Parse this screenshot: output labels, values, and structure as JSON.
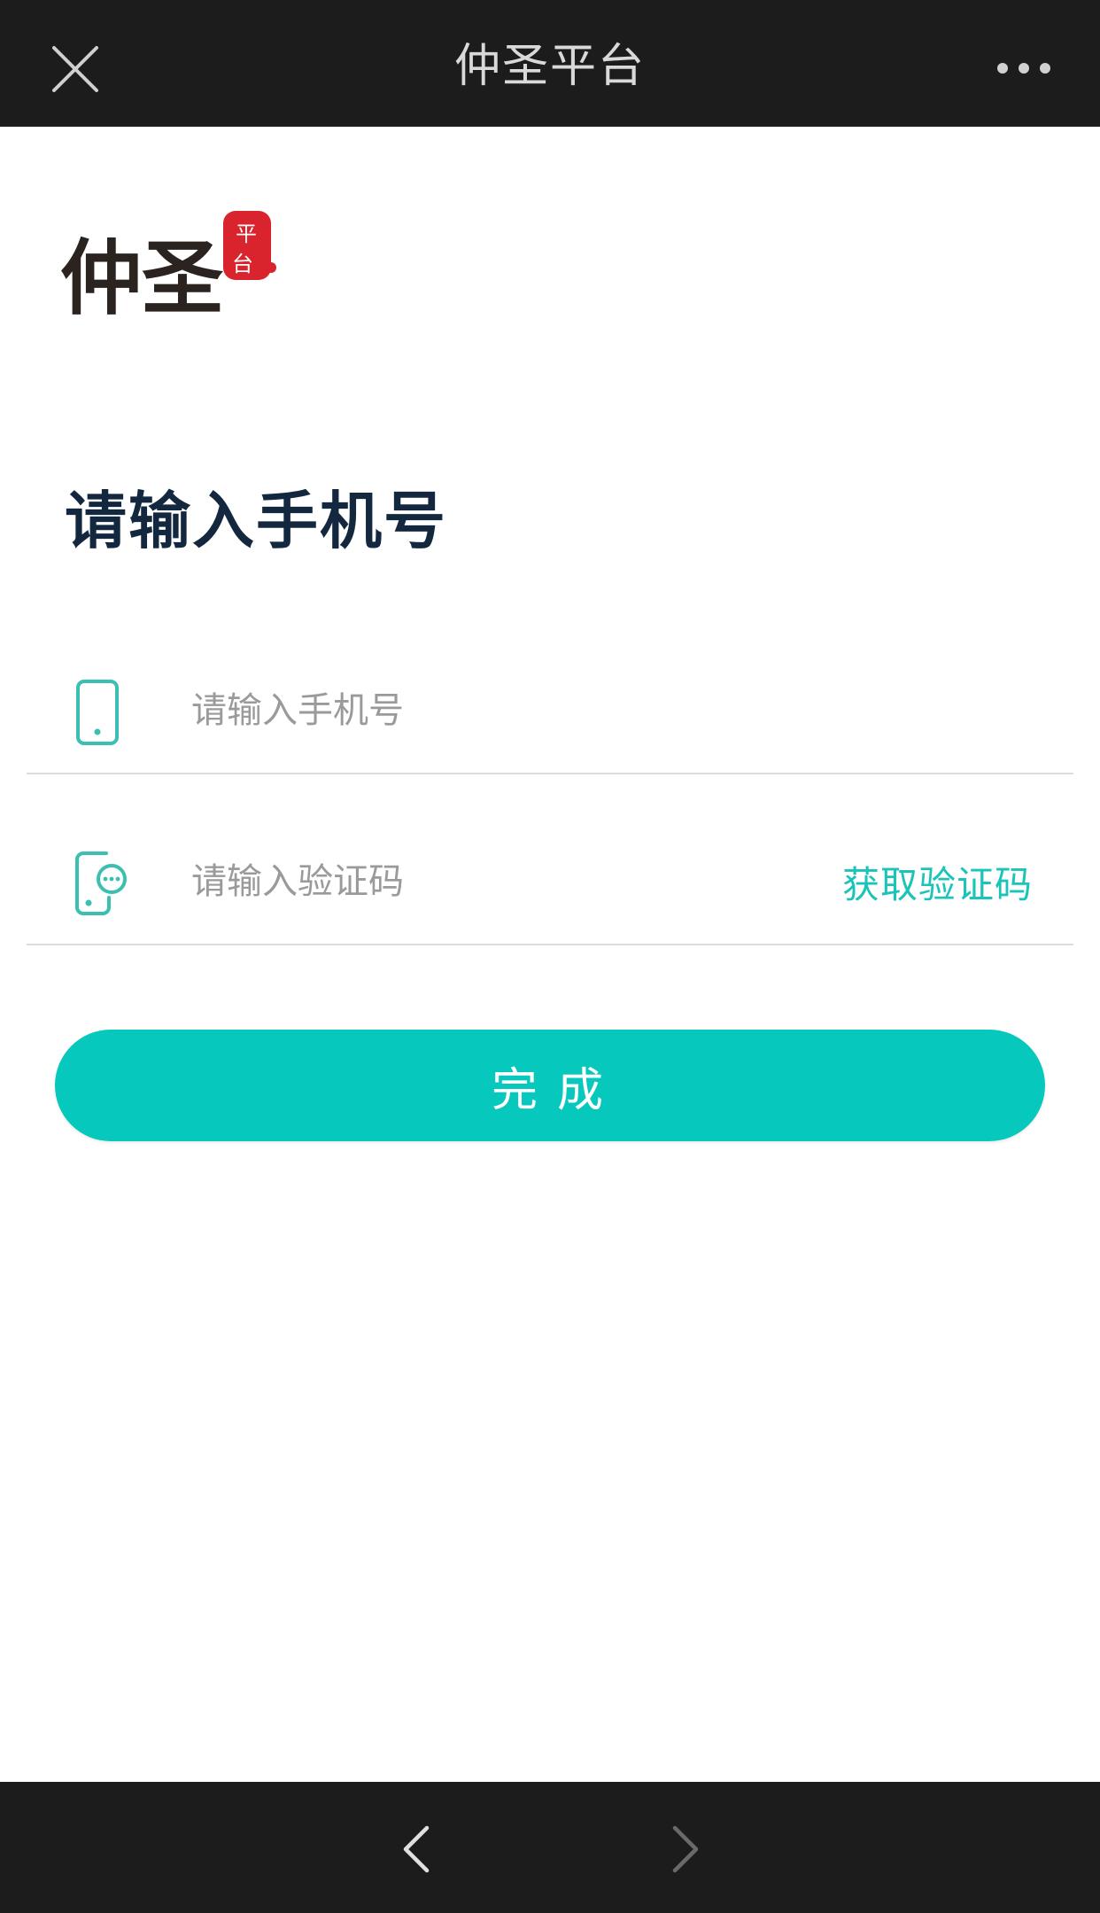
{
  "topbar": {
    "title": "仲圣平台",
    "close_icon": "close-icon",
    "more_icon": "more-icon"
  },
  "logo": {
    "main_text": "仲圣",
    "seal_text": "平台",
    "seal_color": "#d9232d"
  },
  "heading": "请输入手机号",
  "phone_field": {
    "icon": "phone-icon",
    "placeholder": "请输入手机号",
    "value": ""
  },
  "code_field": {
    "icon": "message-phone-icon",
    "placeholder": "请输入验证码",
    "value": "",
    "get_code_label": "获取验证码"
  },
  "submit": {
    "label": "完成"
  },
  "bottombar": {
    "back_icon": "chevron-left-icon",
    "forward_icon": "chevron-right-icon"
  },
  "colors": {
    "accent": "#06c8bd",
    "link": "#1bc4b8",
    "bar": "#1c1c1c",
    "heading": "#13283f"
  }
}
